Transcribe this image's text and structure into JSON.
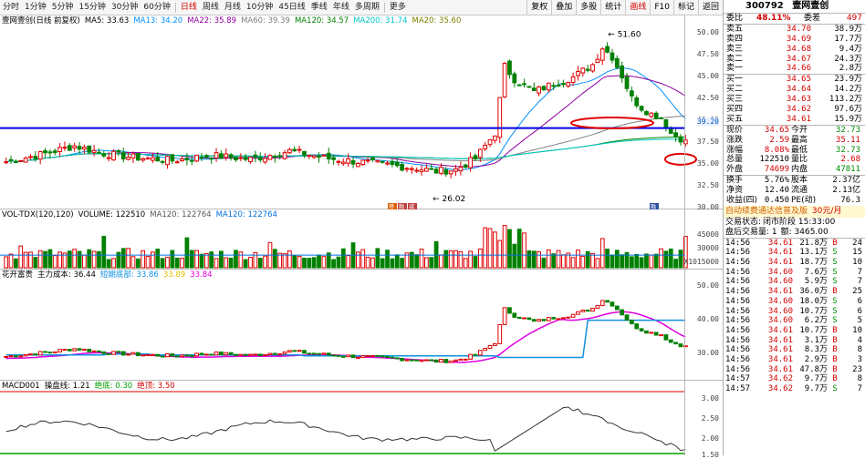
{
  "toolbar": {
    "periods": [
      "分时",
      "1分钟",
      "5分钟",
      "15分钟",
      "30分钟",
      "60分钟",
      "日线",
      "周线",
      "月线",
      "10分钟",
      "45日线",
      "季线",
      "年线",
      "多周期",
      "更多"
    ],
    "active_period": "日线",
    "buttons": [
      "复权",
      "叠加",
      "多股",
      "统计",
      "画线",
      "F10",
      "标记",
      "返回"
    ],
    "active_button": "画线"
  },
  "main_chart": {
    "stock_label": "壹网壹创(日线 前复权)",
    "ma": [
      {
        "label": "MA5: 33.63",
        "color": "#000000"
      },
      {
        "label": "MA13: 34.20",
        "color": "#0090ff"
      },
      {
        "label": "MA22: 35.89",
        "color": "#9000a0"
      },
      {
        "label": "MA60: 39.39",
        "color": "#808080"
      },
      {
        "label": "MA120: 34.57",
        "color": "#008000"
      },
      {
        "label": "MA200: 31.74",
        "color": "#00c8c8"
      },
      {
        "label": "MA20: 35.60",
        "color": "#808000"
      }
    ],
    "y_ticks": [
      "50.00",
      "47.50",
      "45.00",
      "42.50",
      "40.00",
      "37.50",
      "35.00",
      "32.50",
      "30.00"
    ],
    "y_highlight": "39.20",
    "high_label": "51.60",
    "low_label": "26.02",
    "markers": [
      "榜",
      "融",
      "减"
    ],
    "marker_right": "融"
  },
  "volume": {
    "header": "VOL-TDX(120,120)",
    "volume": "VOLUME: 122510",
    "ma120": "MA120: 122764",
    "ma120_b": "MA120: 122764",
    "y_ticks": [
      "45000",
      "30000",
      "15000"
    ],
    "unit": "X10"
  },
  "cost": {
    "header": "花开富贵",
    "main_cost": "主力成本: 36.44",
    "bottom": "短期底部: 33.86",
    "mid": "33.89",
    "low": "33.84",
    "y_ticks": [
      "50.00",
      "40.00",
      "30.00"
    ]
  },
  "macd": {
    "header": "MACD001",
    "op": "操盘线: 1.21",
    "jue_di": "绝底: 0.30",
    "jue_ding": "绝顶: 3.50",
    "y_ticks": [
      "3.00",
      "2.50",
      "2.00",
      "1.50"
    ]
  },
  "quote": {
    "code": "300792",
    "name": "壹网壹创",
    "weibi_label": "委比",
    "weibi": "48.11%",
    "weicha_label": "委差",
    "weicha": "497",
    "sells": [
      {
        "label": "卖五",
        "price": "34.70",
        "vol": "38.9万"
      },
      {
        "label": "卖四",
        "price": "34.69",
        "vol": "17.7万"
      },
      {
        "label": "卖三",
        "price": "34.68",
        "vol": "9.4万"
      },
      {
        "label": "卖二",
        "price": "34.67",
        "vol": "24.3万"
      },
      {
        "label": "卖一",
        "price": "34.66",
        "vol": "2.8万"
      }
    ],
    "buys": [
      {
        "label": "买一",
        "price": "34.65",
        "vol": "23.9万"
      },
      {
        "label": "买二",
        "price": "34.64",
        "vol": "14.2万"
      },
      {
        "label": "买三",
        "price": "34.63",
        "vol": "113.2万"
      },
      {
        "label": "买四",
        "price": "34.62",
        "vol": "97.6万"
      },
      {
        "label": "买五",
        "price": "34.61",
        "vol": "15.9万"
      }
    ],
    "stats": [
      {
        "l1": "现价",
        "v1": "34.65",
        "l2": "今开",
        "v2": "32.73",
        "c1": "red",
        "c2": "green"
      },
      {
        "l1": "涨跌",
        "v1": "2.59",
        "l2": "最高",
        "v2": "35.11",
        "c1": "red",
        "c2": "red"
      },
      {
        "l1": "涨幅",
        "v1": "8.08%",
        "l2": "最低",
        "v2": "32.73",
        "c1": "red",
        "c2": "green"
      },
      {
        "l1": "总量",
        "v1": "122510",
        "l2": "量比",
        "v2": "2.68",
        "c1": "",
        "c2": "red"
      },
      {
        "l1": "外盘",
        "v1": "74699",
        "l2": "内盘",
        "v2": "47811",
        "c1": "red",
        "c2": "green"
      }
    ],
    "stats2": [
      {
        "l1": "换手",
        "v1": "5.76%",
        "l2": "股本",
        "v2": "2.37亿"
      },
      {
        "l1": "净资",
        "v1": "12.40",
        "l2": "流通",
        "v2": "2.13亿"
      },
      {
        "l1": "收益(四)",
        "v1": "0.450",
        "l2": "PE(动)",
        "v2": "76.3"
      }
    ],
    "promo": "自动续费通达信普及版",
    "promo_price": "30元/月",
    "status_label": "交易状态:",
    "status_value": "闭市阶段 15:33:00",
    "after_hours": "盘后交易量: 1",
    "after_amount": "额: 3465.00"
  },
  "ticks": [
    {
      "t": "14:56",
      "p": "34.61",
      "v": "21.8万",
      "bs": "B",
      "n": "24",
      "c": "red"
    },
    {
      "t": "14:56",
      "p": "34.61",
      "v": "13.1万",
      "bs": "S",
      "n": "15",
      "c": "green"
    },
    {
      "t": "14:56",
      "p": "34.61",
      "v": "18.7万",
      "bs": "S",
      "n": "10",
      "c": "green"
    },
    {
      "t": "14:56",
      "p": "34.60",
      "v": "7.6万",
      "bs": "S",
      "n": "7",
      "c": "green"
    },
    {
      "t": "14:56",
      "p": "34.60",
      "v": "5.9万",
      "bs": "S",
      "n": "7",
      "c": "green"
    },
    {
      "t": "14:56",
      "p": "34.61",
      "v": "36.0万",
      "bs": "B",
      "n": "25",
      "c": "red"
    },
    {
      "t": "14:56",
      "p": "34.60",
      "v": "18.0万",
      "bs": "S",
      "n": "6",
      "c": "green"
    },
    {
      "t": "14:56",
      "p": "34.60",
      "v": "10.7万",
      "bs": "S",
      "n": "6",
      "c": "green"
    },
    {
      "t": "14:56",
      "p": "34.60",
      "v": "6.2万",
      "bs": "S",
      "n": "5",
      "c": "green"
    },
    {
      "t": "14:56",
      "p": "34.61",
      "v": "10.7万",
      "bs": "B",
      "n": "10",
      "c": "red"
    },
    {
      "t": "14:56",
      "p": "34.61",
      "v": "3.1万",
      "bs": "B",
      "n": "4",
      "c": "red"
    },
    {
      "t": "14:56",
      "p": "34.61",
      "v": "8.3万",
      "bs": "B",
      "n": "8",
      "c": "red"
    },
    {
      "t": "14:56",
      "p": "34.61",
      "v": "2.9万",
      "bs": "B",
      "n": "3",
      "c": "red"
    },
    {
      "t": "14:56",
      "p": "34.61",
      "v": "47.8万",
      "bs": "B",
      "n": "23",
      "c": "red"
    },
    {
      "t": "14:57",
      "p": "34.62",
      "v": "9.7万",
      "bs": "B",
      "n": "8",
      "c": "red"
    },
    {
      "t": "14:57",
      "p": "34.62",
      "v": "9.7万",
      "bs": "S",
      "n": "7",
      "c": "green"
    }
  ]
}
